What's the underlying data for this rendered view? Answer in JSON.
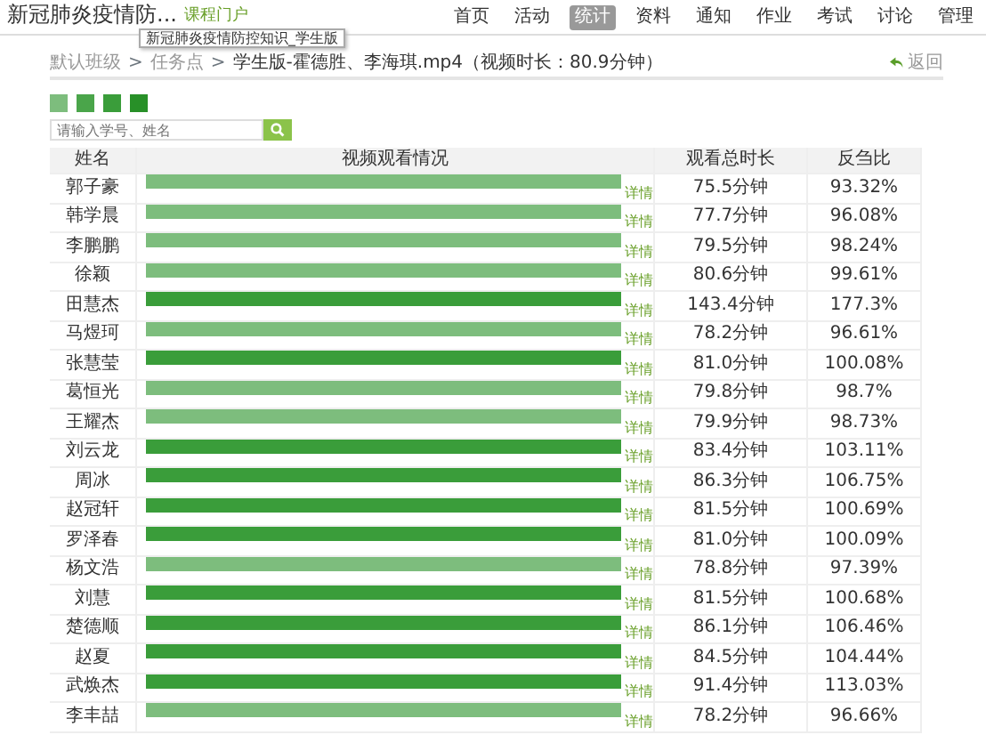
{
  "header": {
    "course_title": "新冠肺炎疫情防...",
    "portal_link": "课程门户",
    "tooltip": "新冠肺炎疫情防控知识_学生版"
  },
  "nav": [
    {
      "label": "首页",
      "selected": false
    },
    {
      "label": "活动",
      "selected": false
    },
    {
      "label": "统计",
      "selected": true
    },
    {
      "label": "资料",
      "selected": false
    },
    {
      "label": "通知",
      "selected": false
    },
    {
      "label": "作业",
      "selected": false
    },
    {
      "label": "考试",
      "selected": false
    },
    {
      "label": "讨论",
      "selected": false
    },
    {
      "label": "管理",
      "selected": false
    }
  ],
  "breadcrumb": {
    "items": [
      "默认班级",
      "任务点"
    ],
    "separator": ">",
    "current": "学生版-霍德胜、李海琪.mp4（视频时长：80.9分钟）",
    "back": "返回"
  },
  "legend": [
    {
      "color": "#7dbd7d"
    },
    {
      "color": "#4aa54a"
    },
    {
      "color": "#3a9d3a"
    },
    {
      "color": "#289028"
    }
  ],
  "search": {
    "placeholder": "请输入学号、姓名"
  },
  "table": {
    "columns": [
      "姓名",
      "视频观看情况",
      "观看总时长",
      "反刍比"
    ],
    "rows": [
      {
        "name": "郭子豪",
        "color": "#7dbd7d",
        "detail": "详情",
        "duration": "75.5分钟",
        "ratio": "93.32%"
      },
      {
        "name": "韩学晨",
        "color": "#7dbd7d",
        "detail": "详情",
        "duration": "77.7分钟",
        "ratio": "96.08%"
      },
      {
        "name": "李鹏鹏",
        "color": "#7dbd7d",
        "detail": "详情",
        "duration": "79.5分钟",
        "ratio": "98.24%"
      },
      {
        "name": "徐颖",
        "color": "#7dbd7d",
        "detail": "详情",
        "duration": "80.6分钟",
        "ratio": "99.61%"
      },
      {
        "name": "田慧杰",
        "color": "#3a9d3a",
        "detail": "详情",
        "duration": "143.4分钟",
        "ratio": "177.3%"
      },
      {
        "name": "马煜珂",
        "color": "#7dbd7d",
        "detail": "详情",
        "duration": "78.2分钟",
        "ratio": "96.61%"
      },
      {
        "name": "张慧莹",
        "color": "#3a9d3a",
        "detail": "详情",
        "duration": "81.0分钟",
        "ratio": "100.08%"
      },
      {
        "name": "葛恒光",
        "color": "#7dbd7d",
        "detail": "详情",
        "duration": "79.8分钟",
        "ratio": "98.7%"
      },
      {
        "name": "王耀杰",
        "color": "#7dbd7d",
        "detail": "详情",
        "duration": "79.9分钟",
        "ratio": "98.73%"
      },
      {
        "name": "刘云龙",
        "color": "#3a9d3a",
        "detail": "详情",
        "duration": "83.4分钟",
        "ratio": "103.11%"
      },
      {
        "name": "周冰",
        "color": "#3a9d3a",
        "detail": "详情",
        "duration": "86.3分钟",
        "ratio": "106.75%"
      },
      {
        "name": "赵冠轩",
        "color": "#3a9d3a",
        "detail": "详情",
        "duration": "81.5分钟",
        "ratio": "100.69%"
      },
      {
        "name": "罗泽春",
        "color": "#3a9d3a",
        "detail": "详情",
        "duration": "81.0分钟",
        "ratio": "100.09%"
      },
      {
        "name": "杨文浩",
        "color": "#7dbd7d",
        "detail": "详情",
        "duration": "78.8分钟",
        "ratio": "97.39%"
      },
      {
        "name": "刘慧",
        "color": "#3a9d3a",
        "detail": "详情",
        "duration": "81.5分钟",
        "ratio": "100.68%"
      },
      {
        "name": "楚德顺",
        "color": "#3a9d3a",
        "detail": "详情",
        "duration": "86.1分钟",
        "ratio": "106.46%"
      },
      {
        "name": "赵夏",
        "color": "#3a9d3a",
        "detail": "详情",
        "duration": "84.5分钟",
        "ratio": "104.44%"
      },
      {
        "name": "武焕杰",
        "color": "#3a9d3a",
        "detail": "详情",
        "duration": "91.4分钟",
        "ratio": "113.03%"
      },
      {
        "name": "李丰喆",
        "color": "#7dbd7d",
        "detail": "详情",
        "duration": "78.2分钟",
        "ratio": "96.66%"
      }
    ]
  }
}
